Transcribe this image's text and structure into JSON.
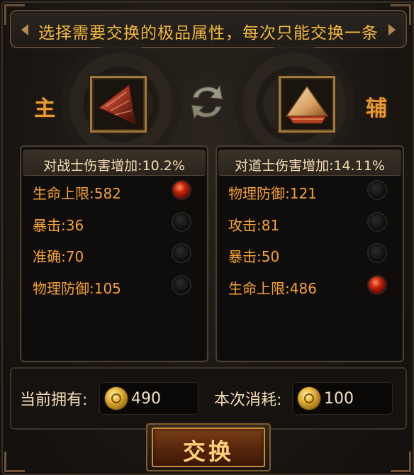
{
  "title": "选择需要交换的极品属性，每次只能交换一条",
  "main_label": "主",
  "aux_label": "辅",
  "main_item_icon": "red-triangle-shard-icon",
  "aux_item_icon": "gold-pyramid-shard-icon",
  "left_panel": {
    "header": "对战士伤害增加:10.2%",
    "attrs": [
      {
        "label": "生命上限:582",
        "selected": true
      },
      {
        "label": "暴击:36",
        "selected": false
      },
      {
        "label": "准确:70",
        "selected": false
      },
      {
        "label": "物理防御:105",
        "selected": false
      }
    ]
  },
  "right_panel": {
    "header": "对道士伤害增加:14.11%",
    "attrs": [
      {
        "label": "物理防御:121",
        "selected": false
      },
      {
        "label": "攻击:81",
        "selected": false
      },
      {
        "label": "暴击:50",
        "selected": false
      },
      {
        "label": "生命上限:486",
        "selected": true
      }
    ]
  },
  "currency": {
    "owned_label": "当前拥有:",
    "owned_value": "490",
    "cost_label": "本次消耗:",
    "cost_value": "100",
    "coin_icon": "gold-coin-icon"
  },
  "exchange_button": "交换",
  "colors": {
    "accent_gold": "#f1b93d",
    "attr_text": "#f5a233",
    "selected_radio": "#c4230c"
  }
}
